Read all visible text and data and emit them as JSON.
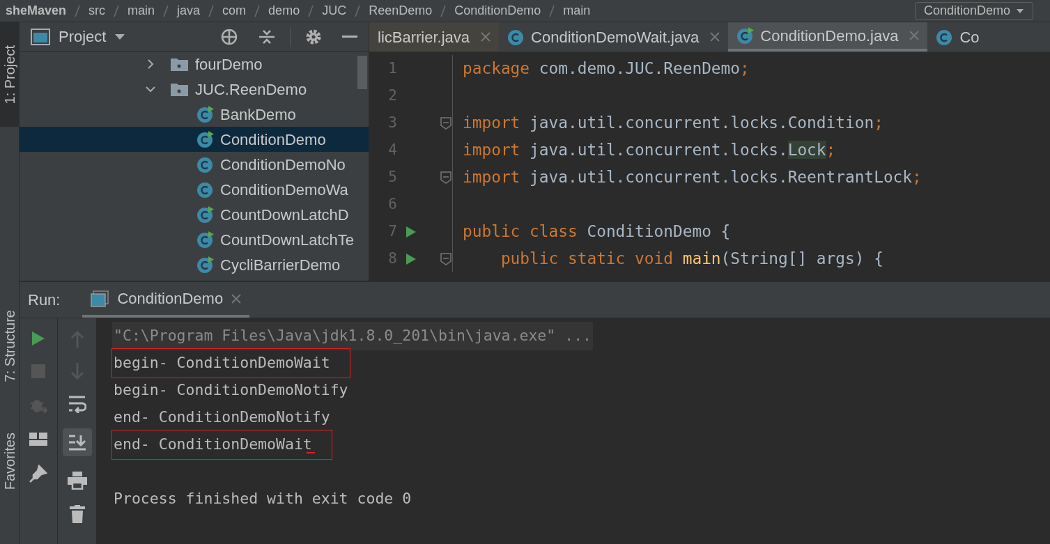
{
  "breadcrumb": [
    "sheMaven",
    "src",
    "main",
    "java",
    "com",
    "demo",
    "JUC",
    "ReenDemo",
    "ConditionDemo",
    "main"
  ],
  "run_config": "ConditionDemo",
  "side_stripe": [
    {
      "label": "1: Project",
      "selected": true
    },
    {
      "label": "7: Structure",
      "selected": false
    },
    {
      "label": "Favorites",
      "selected": false
    }
  ],
  "project_panel": {
    "title": "Project",
    "tree": [
      {
        "label": "fourDemo",
        "kind": "package",
        "expanded": false,
        "selected": false
      },
      {
        "label": "JUC.ReenDemo",
        "kind": "package",
        "expanded": true,
        "selected": false,
        "children": [
          {
            "label": "BankDemo",
            "kind": "runnable",
            "selected": false
          },
          {
            "label": "ConditionDemo",
            "kind": "runnable",
            "selected": true
          },
          {
            "label": "ConditionDemoNo",
            "kind": "class",
            "selected": false
          },
          {
            "label": "ConditionDemoWa",
            "kind": "class",
            "selected": false
          },
          {
            "label": "CountDownLatchD",
            "kind": "runnable",
            "selected": false
          },
          {
            "label": "CountDownLatchTe",
            "kind": "runnable",
            "selected": false
          },
          {
            "label": "CycliBarrierDemo",
            "kind": "runnable",
            "selected": false
          }
        ]
      }
    ]
  },
  "editor": {
    "tabs": [
      {
        "label": "licBarrier.java",
        "selected": false,
        "closable": true
      },
      {
        "label": "ConditionDemoWait.java",
        "runnable": false,
        "selected": false,
        "closable": true
      },
      {
        "label": "ConditionDemo.java",
        "runnable": true,
        "selected": true,
        "closable": true
      },
      {
        "label": "Co",
        "runnable": false,
        "selected": false,
        "closable": false
      }
    ],
    "lines": [
      {
        "number": "1",
        "tokens": [
          {
            "text": "package ",
            "kind": "keyword"
          },
          {
            "text": "com.demo.JUC.ReenDemo",
            "kind": "plain"
          },
          {
            "text": ";",
            "kind": "keyword"
          }
        ]
      },
      {
        "number": "2"
      },
      {
        "number": "3",
        "fold": true,
        "tokens": [
          {
            "text": "import ",
            "kind": "keyword"
          },
          {
            "text": "java.util.concurrent.locks.Condition",
            "kind": "plain"
          },
          {
            "text": ";",
            "kind": "keyword"
          }
        ]
      },
      {
        "number": "4",
        "tokens": [
          {
            "text": "import ",
            "kind": "keyword"
          },
          {
            "text": "java.util.concurrent.locks.",
            "kind": "plain"
          },
          {
            "text": "Lock",
            "kind": "highlight"
          },
          {
            "text": ";",
            "kind": "keyword"
          }
        ]
      },
      {
        "number": "5",
        "fold": true,
        "tokens": [
          {
            "text": "import ",
            "kind": "keyword"
          },
          {
            "text": "java.util.concurrent.locks.ReentrantLock",
            "kind": "plain"
          },
          {
            "text": ";",
            "kind": "keyword"
          }
        ]
      },
      {
        "number": "6"
      },
      {
        "number": "7",
        "run": true,
        "tokens": [
          {
            "text": "public class ",
            "kind": "keyword"
          },
          {
            "text": "ConditionDemo {",
            "kind": "plain"
          }
        ]
      },
      {
        "number": "8",
        "run": true,
        "fold": true,
        "tokens": [
          {
            "text": "    public static void ",
            "kind": "keyword"
          },
          {
            "text": "main",
            "kind": "method"
          },
          {
            "text": "(String[] args) {",
            "kind": "plain"
          }
        ]
      }
    ]
  },
  "run_panel": {
    "label": "Run:",
    "tab": "ConditionDemo",
    "output": [
      {
        "text": "\"C:\\Program Files\\Java\\jdk1.8.0_201\\bin\\java.exe\" ...",
        "kind": "command",
        "highlighted": false
      },
      {
        "text": "begin- ConditionDemoWait",
        "kind": "normal",
        "highlighted": true
      },
      {
        "text": "begin- ConditionDemoNotify",
        "kind": "normal",
        "highlighted": false
      },
      {
        "text": "end- ConditionDemoNotify",
        "kind": "normal",
        "highlighted": false
      },
      {
        "text": "end- ConditionDemoWait",
        "kind": "normal",
        "highlighted": true,
        "caret": true
      },
      {
        "text": "Process finished with exit code 0",
        "kind": "normal",
        "highlighted": false,
        "gap": true
      }
    ]
  }
}
